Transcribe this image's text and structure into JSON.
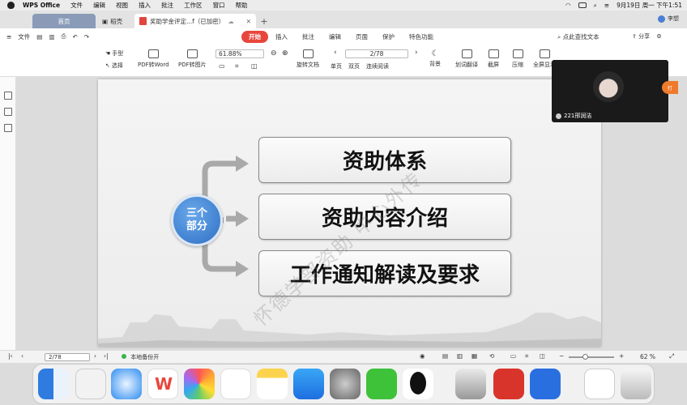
{
  "menubar": {
    "app_name": "WPS Office",
    "items": [
      "文件",
      "编辑",
      "视图",
      "插入",
      "批注",
      "工作区",
      "窗口",
      "帮助"
    ],
    "datetime": "9月19日 周一 下午1:51"
  },
  "tabs": {
    "home": "首页",
    "daoke": "稻壳",
    "doc": "奖助学金评定...f（已加密）",
    "user": "李想"
  },
  "ribbon": {
    "file": "文件",
    "tabs": [
      "开始",
      "插入",
      "批注",
      "编辑",
      "页面",
      "保护",
      "特色功能"
    ],
    "active_tab": "开始",
    "search": "点此查找文本",
    "share": "分享"
  },
  "toolbar": {
    "hand": "手型",
    "select": "选择",
    "pdf_to_word": "PDF转Word",
    "pdf_to_image": "PDF转图片",
    "zoom": "61.88%",
    "rotate": "旋转文档",
    "page": "2/78",
    "single": "单页",
    "double": "双页",
    "continuous": "连续阅读",
    "background": "背景",
    "translate": "划词翻译",
    "screenshot": "截屏",
    "compress": "压缩",
    "fullscreen": "全屏显示"
  },
  "slide": {
    "circle_line1": "三个",
    "circle_line2": "部分",
    "items": [
      "资助体系",
      "资助内容介绍",
      "工作通知解读及要求"
    ],
    "watermark": "怀德学部资助 中心外传"
  },
  "video": {
    "name": "221邢润洁"
  },
  "orange_tab": "打",
  "statusbar": {
    "page": "2/78",
    "backup": "本地备份开",
    "zoom": "62 %"
  }
}
